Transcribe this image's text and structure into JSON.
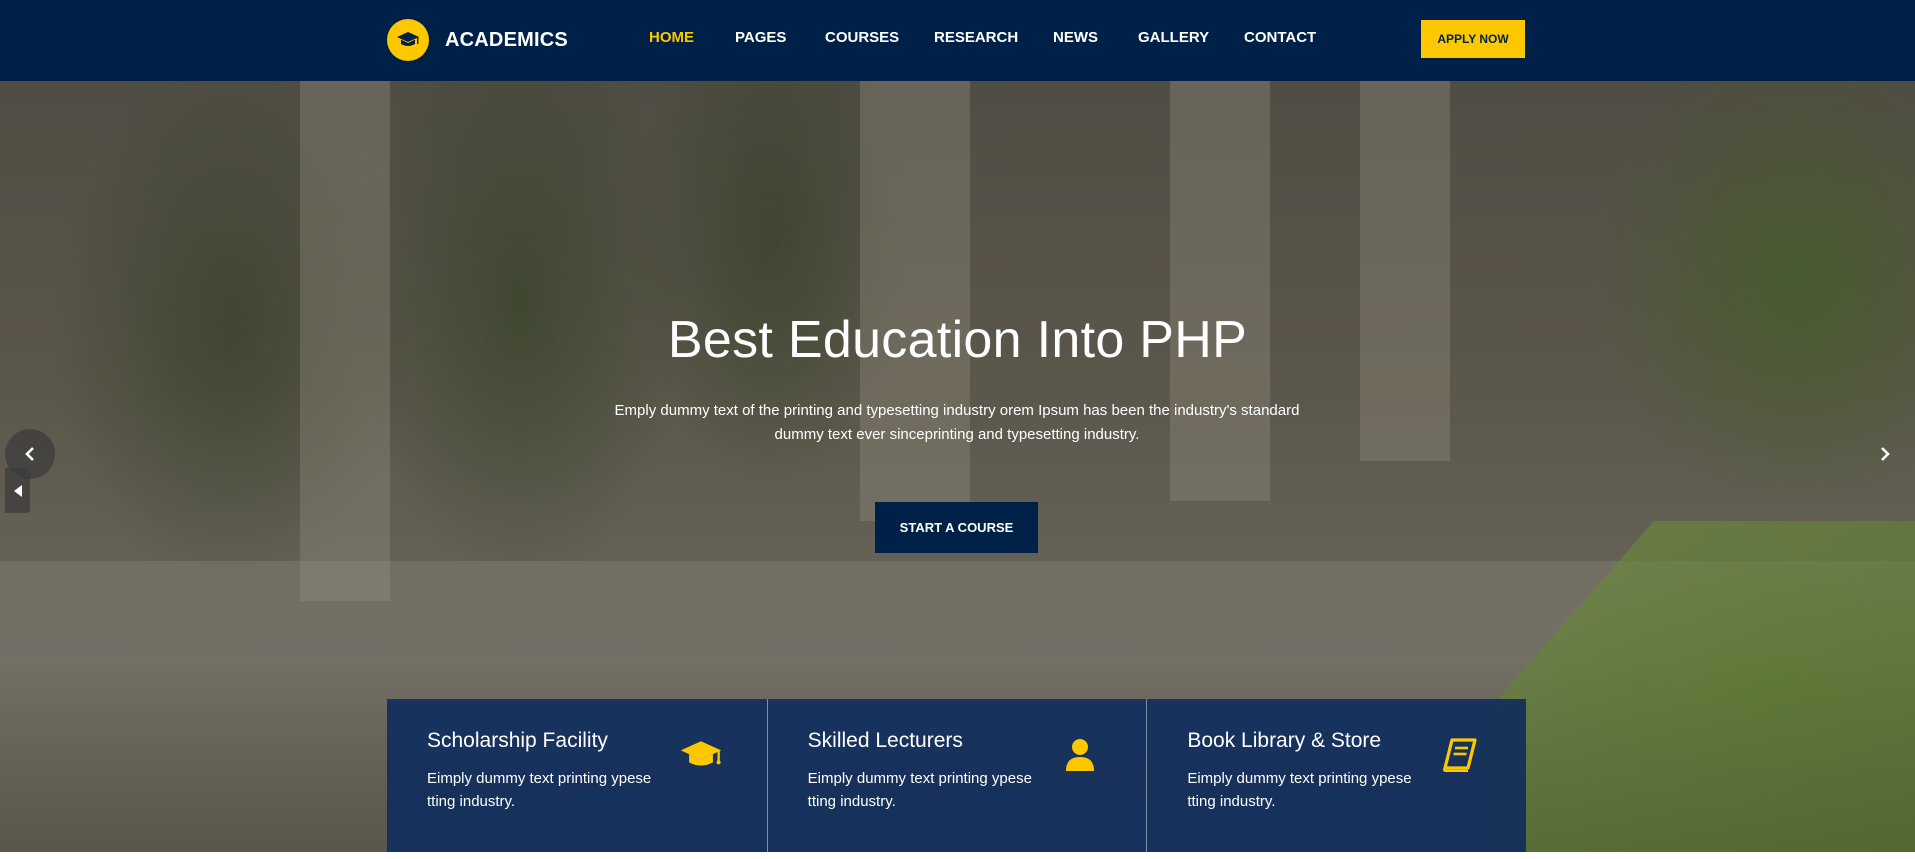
{
  "brand": {
    "name": "ACADEMICS",
    "logo_icon": "graduation-cap-icon",
    "accent": "#fdc800",
    "primary": "#002147"
  },
  "nav": {
    "items": [
      {
        "label": "HOME",
        "active": true
      },
      {
        "label": "PAGES",
        "active": false
      },
      {
        "label": "COURSES",
        "active": false
      },
      {
        "label": "RESEARCH",
        "active": false
      },
      {
        "label": "NEWS",
        "active": false
      },
      {
        "label": "GALLERY",
        "active": false
      },
      {
        "label": "CONTACT",
        "active": false
      }
    ],
    "apply_label": "APPLY NOW"
  },
  "hero": {
    "title": "Best Education Into PHP",
    "subtitle_line1": "Emply dummy text of the printing and typesetting industry orem Ipsum has been the industry's standard",
    "subtitle_line2": "dummy text ever sinceprinting and typesetting industry.",
    "cta_label": "START A COURSE",
    "prev_icon": "chevron-left-icon",
    "next_icon": "chevron-right-icon"
  },
  "features": [
    {
      "title": "Scholarship Facility",
      "text": "Eimply dummy text printing ypese tting industry.",
      "icon": "graduation-cap-icon"
    },
    {
      "title": "Skilled Lecturers",
      "text": "Eimply dummy text printing ypese tting industry.",
      "icon": "user-icon"
    },
    {
      "title": "Book Library & Store",
      "text": "Eimply dummy text printing ypese tting industry.",
      "icon": "book-icon"
    }
  ]
}
